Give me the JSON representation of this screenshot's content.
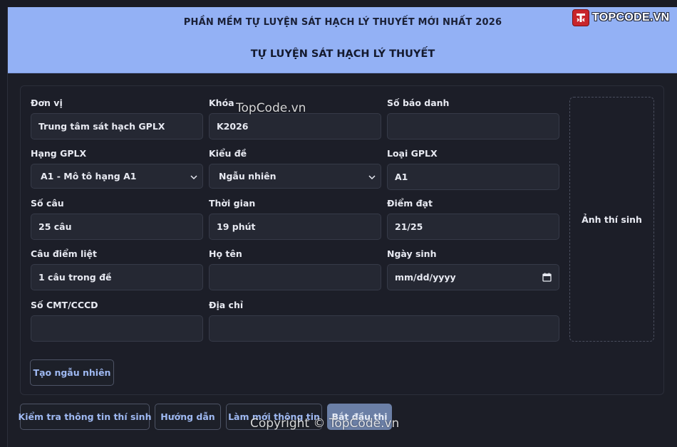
{
  "header": {
    "subtitle": "PHẦN MỀM TỰ LUYỆN SÁT HẠCH LÝ THUYẾT MỚI NHẤT 2026",
    "title": "TỰ LUYỆN SÁT HẠCH LÝ THUYẾT",
    "logo_text": "TOPCODE.VN"
  },
  "form": {
    "don_vi": {
      "label": "Đơn vị",
      "value": "Trung tâm sát hạch GPLX"
    },
    "khoa": {
      "label": "Khóa",
      "value": "K2026"
    },
    "so_bao_danh": {
      "label": "Số báo danh",
      "value": ""
    },
    "hang_gplx": {
      "label": "Hạng GPLX",
      "value": "A1 - Mô tô hạng A1"
    },
    "kieu_de": {
      "label": "Kiểu đề",
      "value": "Ngẫu nhiên"
    },
    "loai_gplx": {
      "label": "Loại GPLX",
      "value": "A1"
    },
    "so_cau": {
      "label": "Số câu",
      "value": "25 câu"
    },
    "thoi_gian": {
      "label": "Thời gian",
      "value": "19 phút"
    },
    "diem_dat": {
      "label": "Điểm đạt",
      "value": "21/25"
    },
    "cau_diem_liet": {
      "label": "Câu điểm liệt",
      "value": "1 câu trong đề"
    },
    "ho_ten": {
      "label": "Họ tên",
      "value": ""
    },
    "ngay_sinh": {
      "label": "Ngày sinh",
      "placeholder": "mm/dd/yyyy"
    },
    "so_cmt": {
      "label": "Số CMT/CCCD",
      "value": ""
    },
    "dia_chi": {
      "label": "Địa chỉ",
      "value": ""
    },
    "photo_label": "Ảnh thí sinh",
    "random_button": "Tạo ngẫu nhiên"
  },
  "actions": {
    "check_info": "Kiểm tra thông tin thí sinh",
    "guide": "Hướng dẫn",
    "refresh": "Làm mới thông tin",
    "start": "Bắt đầu thi"
  },
  "watermarks": {
    "top": "TopCode.vn",
    "bottom": "Copyright © TopCode.vn"
  },
  "colors": {
    "header_bg": "#93b1f5",
    "page_bg": "#191b24",
    "accent_text": "#9fb9f2",
    "logo_red": "#c8252b"
  }
}
